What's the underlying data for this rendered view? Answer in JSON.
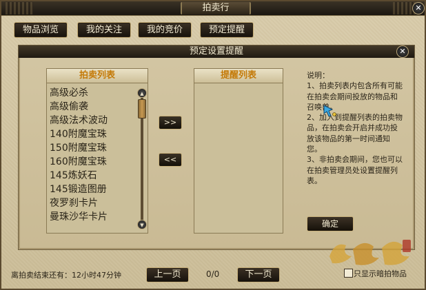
{
  "window": {
    "title": "拍卖行",
    "close_label": "✕"
  },
  "tabs": [
    {
      "label": "物品浏览"
    },
    {
      "label": "我的关注"
    },
    {
      "label": "我的竞价"
    },
    {
      "label": "预定提醒"
    }
  ],
  "dialog": {
    "title": "预定设置提醒",
    "close_label": "✕",
    "auction_list": {
      "header": "拍卖列表",
      "items": [
        "高级必杀",
        "高级偷袭",
        "高级法术波动",
        "140附魔宝珠",
        "150附魔宝珠",
        "160附魔宝珠",
        "145炼妖石",
        "145锻造图册",
        "夜罗刹卡片",
        "曼珠沙华卡片"
      ]
    },
    "reminder_list": {
      "header": "提醒列表"
    },
    "add_button_label": ">>",
    "remove_button_label": "<<",
    "description": {
      "title": "说明：",
      "lines": [
        "1、拍卖列表内包含所有可能在拍卖会期间投放的物品和召唤兽。",
        "2、加入到提醒列表的拍卖物品，在拍卖会开启并成功投放该物品的第一时间通知您。",
        "3、非拍卖会期间，您也可以在拍卖管理员处设置提醒列表。"
      ]
    },
    "confirm_label": "确定"
  },
  "footer": {
    "remaining_text": "离拍卖结束还有：12小时47分钟",
    "prev_label": "上一页",
    "page_indicator": "0/0",
    "next_label": "下一页",
    "checkbox_label": "只显示暗拍物品",
    "checkbox_checked": false
  },
  "colors": {
    "accent_header": "#c47a08",
    "panel_bg": "#cbbf9a",
    "button_bg": "#1f1910",
    "button_border": "#c8b07a"
  }
}
